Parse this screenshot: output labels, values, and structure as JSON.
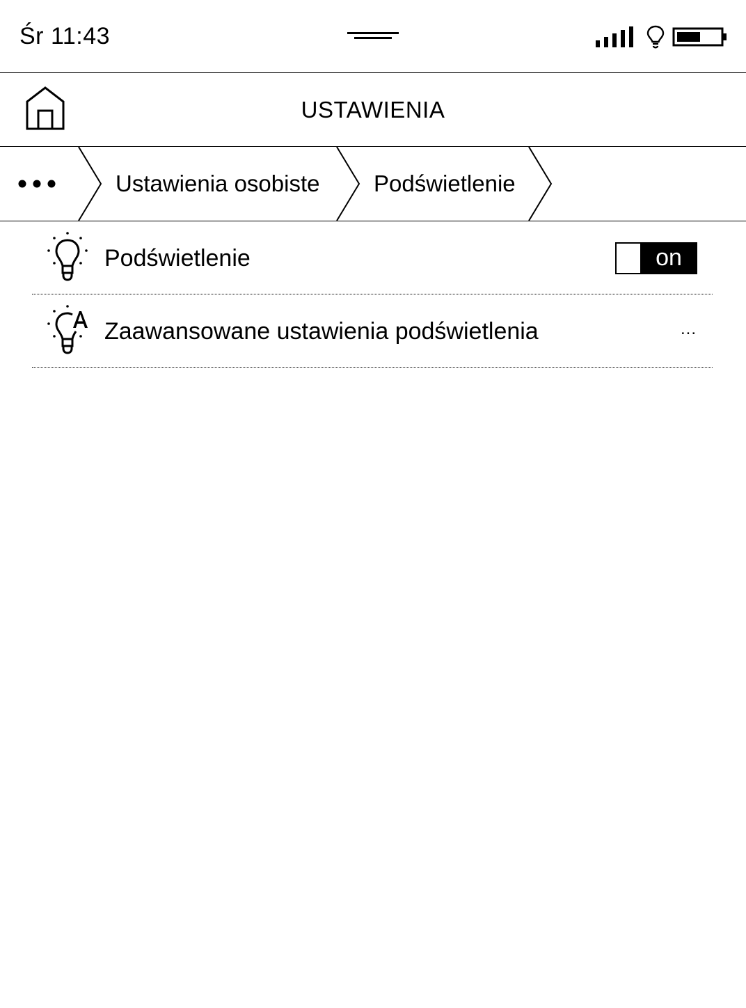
{
  "status_bar": {
    "time": "Śr 11:43",
    "icons": [
      "drag-handle-icon",
      "signal-strength-icon",
      "frontlight-icon",
      "battery-icon"
    ],
    "battery_level": 0.55,
    "signal_bars": 5
  },
  "header": {
    "title": "USTAWIENIA",
    "home_icon": "home-icon"
  },
  "breadcrumb": {
    "more_icon": "ellipsis-icon",
    "items": [
      {
        "label": "Ustawienia osobiste"
      },
      {
        "label": "Podświetlenie"
      }
    ]
  },
  "settings": {
    "items": [
      {
        "label": "Podświetlenie",
        "icon": "lightbulb-icon",
        "control": "toggle",
        "toggle_label": "on",
        "toggle_state": true
      },
      {
        "label": "Zaawansowane ustawienia podświetlenia",
        "icon": "lightbulb-a-icon",
        "control": "more",
        "more_label": "..."
      }
    ]
  },
  "colors": {
    "background": "#ffffff",
    "foreground": "#000000"
  }
}
